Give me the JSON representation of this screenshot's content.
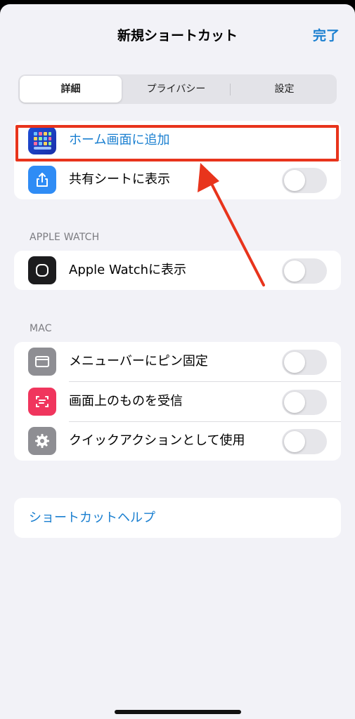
{
  "header": {
    "title": "新規ショートカット",
    "done_label": "完了"
  },
  "tabs": [
    {
      "label": "詳細",
      "active": true
    },
    {
      "label": "プライバシー",
      "active": false
    },
    {
      "label": "設定",
      "active": false
    }
  ],
  "share_group": {
    "home_label": "ホーム画面に追加",
    "share_sheet_label": "共有シートに表示",
    "share_sheet_on": false
  },
  "watch_section": {
    "header": "APPLE WATCH",
    "watch_label": "Apple Watchに表示",
    "watch_on": false
  },
  "mac_section": {
    "header": "MAC",
    "items": [
      {
        "label": "メニューバーにピン固定",
        "on": false
      },
      {
        "label": "画面上のものを受信",
        "on": false
      },
      {
        "label": "クイックアクションとして使用",
        "on": false
      }
    ]
  },
  "help": {
    "label": "ショートカットヘルプ"
  },
  "colors": {
    "accent": "#1a7fd0",
    "highlight": "#e8341c",
    "share_icon_bg": "#2f8cf5",
    "watch_icon_bg": "#1c1c1e",
    "menubar_icon_bg": "#8e8e93",
    "receive_icon_bg": "#f0355d",
    "quick_action_icon_bg": "#8e8e93"
  },
  "icons": {
    "home": "home-screen-apps-icon",
    "share": "share-icon",
    "watch": "apple-watch-icon",
    "menubar": "menubar-window-icon",
    "receive": "screen-scan-icon",
    "quick_action": "gear-icon"
  }
}
